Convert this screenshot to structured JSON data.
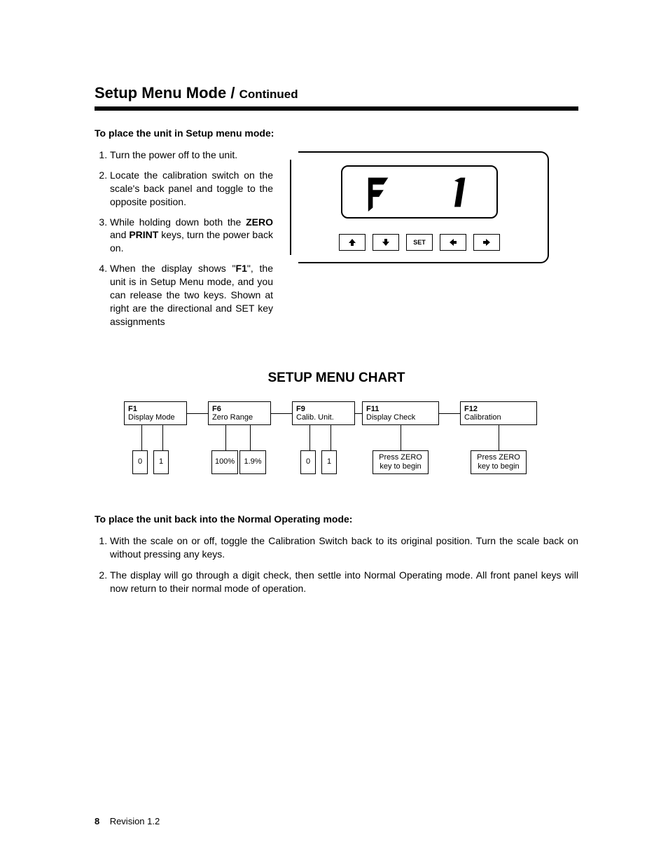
{
  "header": {
    "title_main": "Setup Menu Mode",
    "title_sep": " / ",
    "title_cont": "Continued"
  },
  "section1": {
    "heading": "To place the unit in Setup menu mode:",
    "steps": [
      "Turn the power off to the unit.",
      "Locate the calibration switch on the scale's back panel and toggle to the opposite position.",
      "While holding down both the ZERO and PRINT keys, turn the power back on.",
      "When the display shows \"F1\", the unit is in Setup Menu mode, and you can release the two keys. Shown at right are the directional and SET key assignments"
    ],
    "keys_set_label": "SET"
  },
  "chart": {
    "title": "SETUP MENU CHART",
    "items": [
      {
        "code": "F1",
        "label": "Display Mode",
        "options": [
          "0",
          "1"
        ]
      },
      {
        "code": "F6",
        "label": "Zero Range",
        "options": [
          "100%",
          "1.9%"
        ]
      },
      {
        "code": "F9",
        "label": "Calib. Unit.",
        "options": [
          "0",
          "1"
        ]
      },
      {
        "code": "F11",
        "label": "Display Check",
        "options": [
          "Press ZERO key to begin"
        ]
      },
      {
        "code": "F12",
        "label": "Calibration",
        "options": [
          "Press ZERO key to begin"
        ]
      }
    ]
  },
  "section2": {
    "heading": "To place the unit back into the Normal Operating mode:",
    "steps": [
      "With the scale on or off, toggle the Calibration Switch back to its original position. Turn the scale back on without pressing any keys.",
      "The display will go through a digit check, then settle into Normal Operating mode. All front panel keys will now return to their normal mode of operation."
    ]
  },
  "footer": {
    "page_number": "8",
    "revision": "Revision 1.2"
  }
}
